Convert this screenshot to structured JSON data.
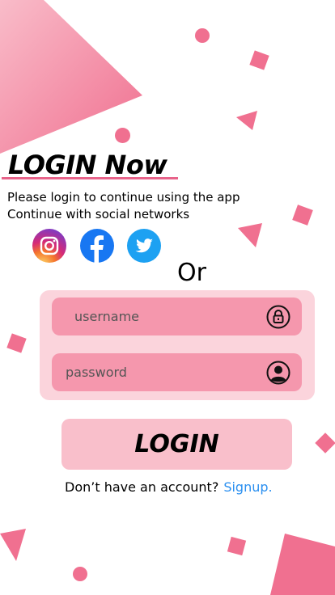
{
  "title": "LOGIN Now",
  "subtitle_line1": "Please login to continue using the app",
  "subtitle_line2": "Continue with social networks",
  "social": [
    {
      "name": "Instagram",
      "icon": "instagram-icon"
    },
    {
      "name": "Facebook",
      "icon": "facebook-icon",
      "color": "#1877f2"
    },
    {
      "name": "Twitter",
      "icon": "twitter-icon",
      "color": "#1da1f2"
    }
  ],
  "or_label": "Or",
  "username": {
    "placeholder": "username",
    "icon": "lock-icon"
  },
  "password": {
    "placeholder": "password",
    "icon": "user-icon"
  },
  "login_button": "LOGIN",
  "signup": {
    "prompt": "Don’t have an account?",
    "link": "Signup."
  },
  "colors": {
    "accent": "#f07090",
    "field": "#f597ad",
    "form_bg": "#fbd4dc",
    "button": "#f9bfcb",
    "link": "#2a8ff0"
  }
}
